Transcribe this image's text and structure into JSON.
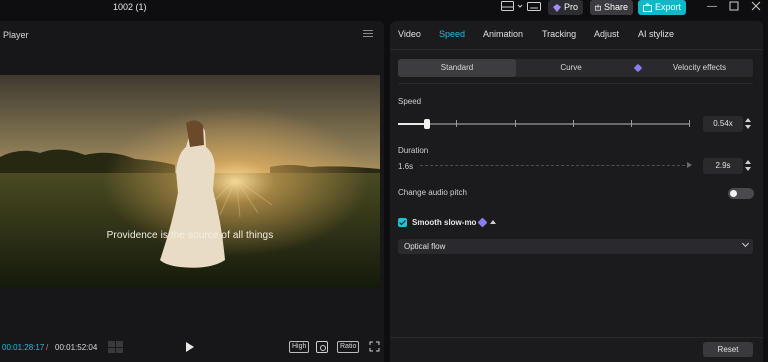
{
  "app": {
    "project_title": "1002 (1)",
    "pro_label": "Pro",
    "share_label": "Share",
    "export_label": "Export",
    "accent_color": "#1ec2d4"
  },
  "player": {
    "title": "Player",
    "subtitle_text": "Providence is the source of all things",
    "current_time": "00:01:28:17",
    "separator": "/",
    "total_time": "00:01:52:04",
    "quality_label": "High",
    "ratio_label": "Ratio"
  },
  "inspector": {
    "tabs": [
      {
        "label": "Video",
        "active": false
      },
      {
        "label": "Speed",
        "active": true
      },
      {
        "label": "Animation",
        "active": false
      },
      {
        "label": "Tracking",
        "active": false
      },
      {
        "label": "Adjust",
        "active": false
      },
      {
        "label": "AI stylize",
        "active": false
      }
    ],
    "modes": [
      {
        "label": "Standard",
        "active": true
      },
      {
        "label": "Curve",
        "active": false
      },
      {
        "label": "Velocity effects",
        "active": false
      }
    ],
    "speed": {
      "label": "Speed",
      "value": "0.54x",
      "slider_level": 0.1
    },
    "duration": {
      "label": "Duration",
      "original": "1.6s",
      "value": "2.9s"
    },
    "audio_pitch": {
      "label": "Change audio pitch",
      "enabled": false
    },
    "smooth": {
      "label": "Smooth slow-mo",
      "checked": true,
      "method": "Optical flow"
    },
    "reset_label": "Reset"
  }
}
